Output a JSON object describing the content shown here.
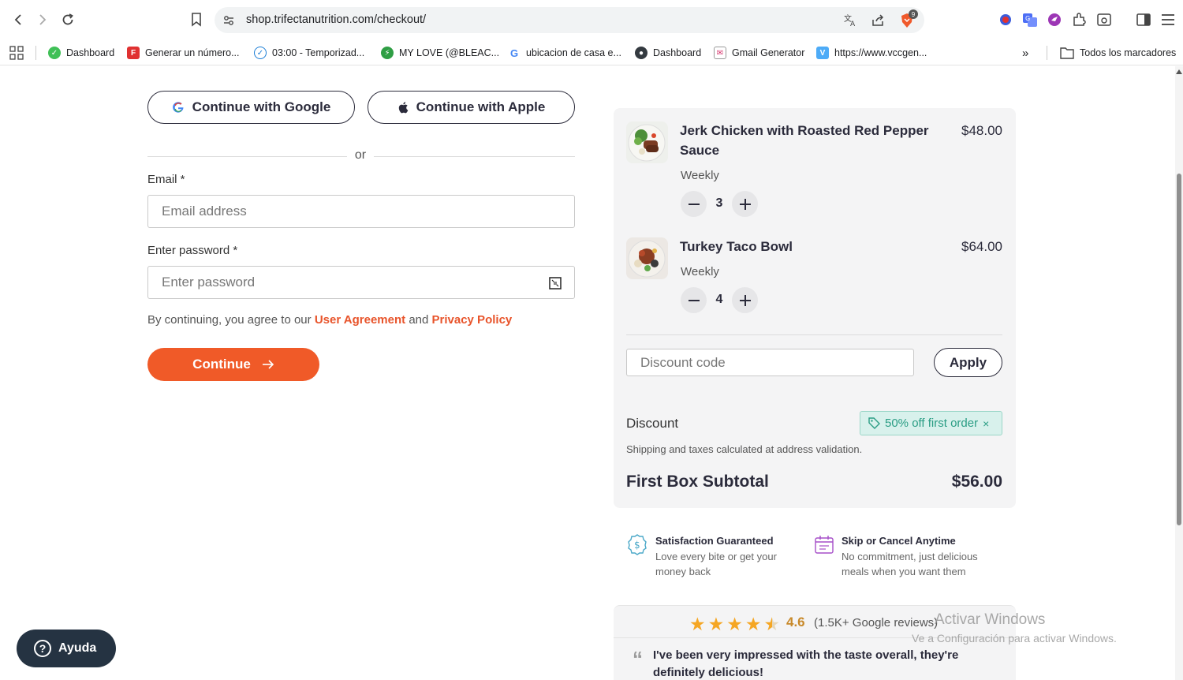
{
  "browser": {
    "url": "shop.trifectanutrition.com/checkout/",
    "extension_badge_count": "9",
    "bookmarks": [
      {
        "label": "Dashboard",
        "icon": "green-circle-icon"
      },
      {
        "label": "Generar un número...",
        "icon": "red-f-icon"
      },
      {
        "label": "03:00 - Temporizad...",
        "icon": "check-clock-icon"
      },
      {
        "label": "MY LOVE (@BLEAC...",
        "icon": "green-bolt-icon"
      },
      {
        "label": "ubicacion de casa e...",
        "icon": "google-g-icon"
      },
      {
        "label": "Dashboard",
        "icon": "dark-circle-icon"
      },
      {
        "label": "Gmail Generator",
        "icon": "mail-icon"
      },
      {
        "label": "https://www.vccgen...",
        "icon": "blue-v-icon"
      }
    ],
    "all_bookmarks_label": "Todos los marcadores"
  },
  "auth": {
    "google_label": "Continue with Google",
    "apple_label": "Continue with Apple",
    "or_label": "or",
    "email_label": "Email *",
    "email_placeholder": "Email address",
    "password_label": "Enter password *",
    "password_placeholder": "Enter password",
    "consent_prefix": "By continuing, you agree to our",
    "consent_link_1": "User Agreement",
    "consent_and": "and",
    "consent_link_2": "Privacy Policy",
    "continue_label": "Continue"
  },
  "summary": {
    "items": [
      {
        "title": "Jerk Chicken with Roasted Red Pepper Sauce",
        "price": "$48.00",
        "frequency": "Weekly",
        "quantity": "3"
      },
      {
        "title": "Turkey Taco Bowl",
        "price": "$64.00",
        "frequency": "Weekly",
        "quantity": "4"
      }
    ],
    "discount_placeholder": "Discount code",
    "apply_label": "Apply",
    "discount_label": "Discount",
    "discount_badge": "50% off first order",
    "shipping_note": "Shipping and taxes calculated at address validation.",
    "subtotal_label": "First Box Subtotal",
    "subtotal_value": "$56.00"
  },
  "guarantees": [
    {
      "title": "Satisfaction Guaranteed",
      "text": "Love every bite or get your money back",
      "icon": "dollar-badge-icon"
    },
    {
      "title": "Skip or Cancel Anytime",
      "text": "No commitment, just delicious meals when you want them",
      "icon": "calendar-icon"
    }
  ],
  "reviews": {
    "rating": "4.6",
    "count": "(1.5K+ Google reviews)",
    "stars": 4.5,
    "quote": "I've been very impressed with the taste overall, they're definitely delicious!"
  },
  "watermark": {
    "line1": "Activar Windows",
    "line2": "Ve a Configuración para activar Windows."
  },
  "help": {
    "label": "Ayuda"
  },
  "colors": {
    "accent": "#f05a28",
    "link": "#e8542b",
    "badge_bg": "#d8f1ec",
    "badge_text": "#2a9d84",
    "help_bg": "#253342"
  }
}
